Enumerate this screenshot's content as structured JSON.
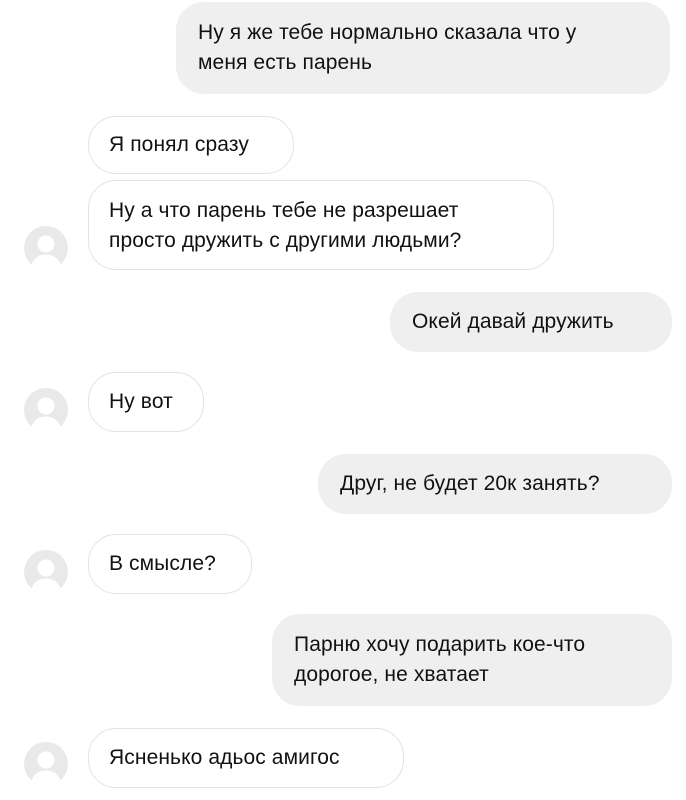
{
  "messages": [
    {
      "side": "out",
      "lines": [
        "Ну я же тебе нормально сказала что у",
        "меня есть парень"
      ]
    },
    {
      "side": "in",
      "lines": [
        "Я понял сразу"
      ]
    },
    {
      "side": "in",
      "lines": [
        "Ну а что парень тебе не разрешает",
        "просто дружить с другими людьми?"
      ]
    },
    {
      "side": "out",
      "lines": [
        "Окей давай дружить"
      ]
    },
    {
      "side": "in",
      "lines": [
        "Ну вот"
      ]
    },
    {
      "side": "out",
      "lines": [
        "Друг, не будет 20к занять?"
      ]
    },
    {
      "side": "in",
      "lines": [
        "В смысле?"
      ]
    },
    {
      "side": "out",
      "lines": [
        "Парню хочу подарить кое-что",
        "дорогое, не хватает"
      ]
    },
    {
      "side": "in",
      "lines": [
        "Ясненько адьос амигос"
      ]
    }
  ],
  "colors": {
    "outgoing_bubble": "#efefef",
    "incoming_border": "#e3e3e3",
    "avatar_bg": "#e9e9e9",
    "avatar_fg": "#ffffff"
  },
  "icons": {
    "avatar": "default-user-avatar-icon"
  }
}
